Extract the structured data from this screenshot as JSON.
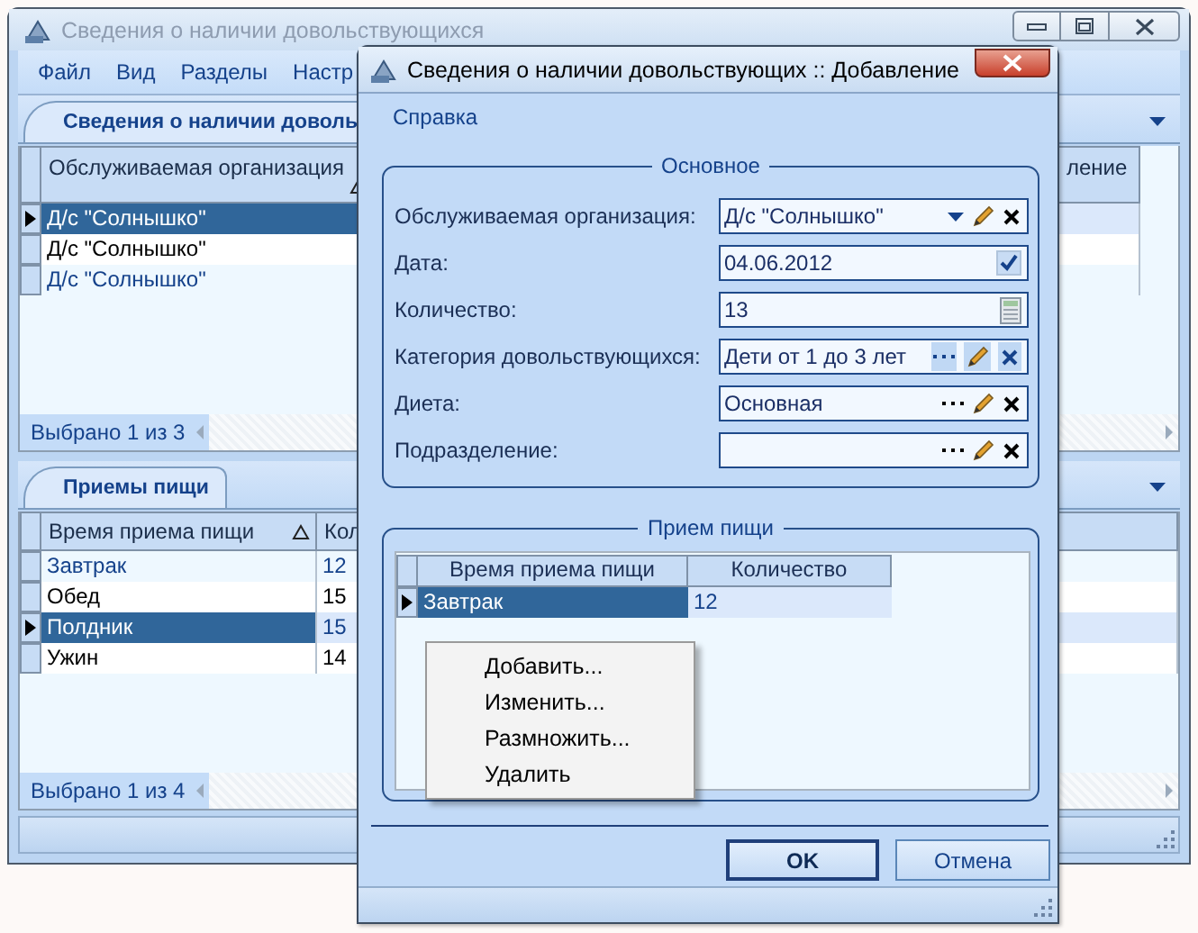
{
  "main_window": {
    "title": "Сведения о наличии довольствующихся",
    "active": false,
    "menu": [
      {
        "label": "Файл"
      },
      {
        "label": "Вид"
      },
      {
        "label": "Разделы"
      },
      {
        "label": "Настр"
      }
    ],
    "panels": [
      {
        "tab": "Сведения о наличии доволь",
        "columns": [
          {
            "label": "Обслуживаемая организация",
            "sorted": true
          },
          {
            "label": "ление",
            "sorted": false
          }
        ],
        "rows": [
          {
            "cells": [
              "Д/с \"Солнышко\""
            ],
            "selected": true
          },
          {
            "cells": [
              "Д/с \"Солнышко\""
            ],
            "selected": false
          },
          {
            "cells": [
              "Д/с \"Солнышко\""
            ],
            "selected": false
          }
        ],
        "footer": "Выбрано 1 из 3"
      },
      {
        "tab": "Приемы пищи",
        "columns": [
          {
            "label": "Время приема пищи",
            "sorted": true
          },
          {
            "label": "Кол",
            "sorted": false
          }
        ],
        "rows": [
          {
            "cells": [
              "Завтрак",
              "12"
            ],
            "selected": false
          },
          {
            "cells": [
              "Обед",
              "15"
            ],
            "selected": false
          },
          {
            "cells": [
              "Полдник",
              "15"
            ],
            "selected": true
          },
          {
            "cells": [
              "Ужин",
              "14"
            ],
            "selected": false
          }
        ],
        "footer": "Выбрано 1 из 4"
      }
    ]
  },
  "dialog": {
    "title": "Сведения о наличии довольствующих :: Добавление",
    "active": true,
    "menu": [
      {
        "label": "Справка"
      }
    ],
    "main_group": {
      "title": "Основное",
      "fields": [
        {
          "label": "Обслуживаемая организация:",
          "value": "Д/с \"Солнышко\"",
          "kind": "lookup",
          "hovered": false
        },
        {
          "label": "Дата:",
          "value": "04.06.2012",
          "kind": "date",
          "hovered": false
        },
        {
          "label": "Количество:",
          "value": "13",
          "kind": "number",
          "hovered": false
        },
        {
          "label": "Категория довольствующихся:",
          "value": "Дети от 1 до 3 лет",
          "kind": "picker",
          "hovered": true
        },
        {
          "label": "Диета:",
          "value": "Основная",
          "kind": "picker",
          "hovered": false
        },
        {
          "label": "Подразделение:",
          "kind": "picker",
          "hovered": false
        }
      ]
    },
    "meals_group": {
      "title": "Прием пищи",
      "columns": [
        {
          "label": "Время приема пищи"
        },
        {
          "label": "Количество"
        }
      ],
      "rows": [
        {
          "cells": [
            "Завтрак",
            "12"
          ],
          "selected": true
        }
      ]
    },
    "context_menu": [
      {
        "label": "Добавить..."
      },
      {
        "label": "Изменить..."
      },
      {
        "label": "Размножить..."
      },
      {
        "label": "Удалить"
      }
    ],
    "buttons": [
      {
        "label": "OK",
        "default": true
      },
      {
        "label": "Отмена",
        "default": false
      }
    ]
  }
}
